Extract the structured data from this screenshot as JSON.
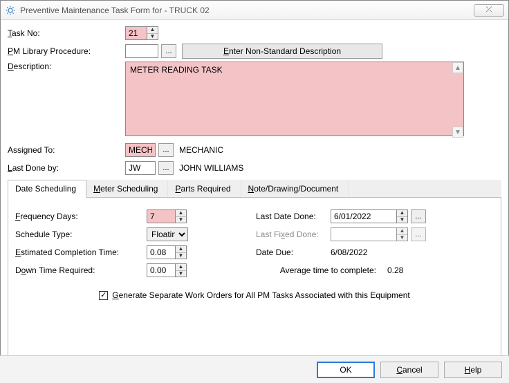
{
  "window": {
    "title": "Preventive Maintenance Task Form for - TRUCK 02",
    "close_glyph": "⤫"
  },
  "labels": {
    "task_no": "Task No:",
    "task_no_u": "T",
    "pm_lib": "PM Library Procedure:",
    "pm_lib_u": "P",
    "desc": "Description:",
    "desc_u": "D",
    "assigned": "Assigned To:",
    "lastdone": "Last Done by:",
    "lastdone_u": "L",
    "nonstd_btn": "Enter Non-Standard Description",
    "nonstd_u": "E"
  },
  "fields": {
    "task_no": "21",
    "pm_lib": "",
    "description": "METER READING TASK",
    "assigned_code": "MECH",
    "assigned_name": "MECHANIC",
    "lastdone_code": "JW",
    "lastdone_name": "JOHN WILLIAMS"
  },
  "tabs": {
    "t1": "Date Scheduling",
    "t2": "Meter Scheduling",
    "t2_u": "M",
    "t3": "Parts Required",
    "t3_u": "P",
    "t4": "Note/Drawing/Document",
    "t4_u": "N"
  },
  "sched": {
    "freq_lbl": "Frequency Days:",
    "freq_u": "F",
    "schedtype_lbl": "Schedule Type:",
    "ect_lbl": "Estimated Completion Time:",
    "ect_u": "E",
    "dtr_lbl": "Down Time Required:",
    "dtr_u": "o",
    "ldd_lbl": "Last Date Done:",
    "lfd_lbl": "Last Fixed Done:",
    "lfd_u": "x",
    "due_lbl": "Date Due:",
    "avg_lbl": "Average time to complete:",
    "freq_val": "7",
    "schedtype_val": "Floating",
    "ect_val": "0.08",
    "dtr_val": "0.00",
    "ldd_val": "6/01/2022",
    "lfd_val": "",
    "due_val": "6/08/2022",
    "avg_val": "0.28",
    "chk_lbl": "Generate Separate Work Orders for All PM Tasks Associated with this Equipment",
    "chk_u": "G",
    "chk_checked": "✓"
  },
  "buttons": {
    "ok": "OK",
    "cancel": "Cancel",
    "cancel_u": "C",
    "help": "Help",
    "help_u": "H",
    "ellipsis": "..."
  }
}
